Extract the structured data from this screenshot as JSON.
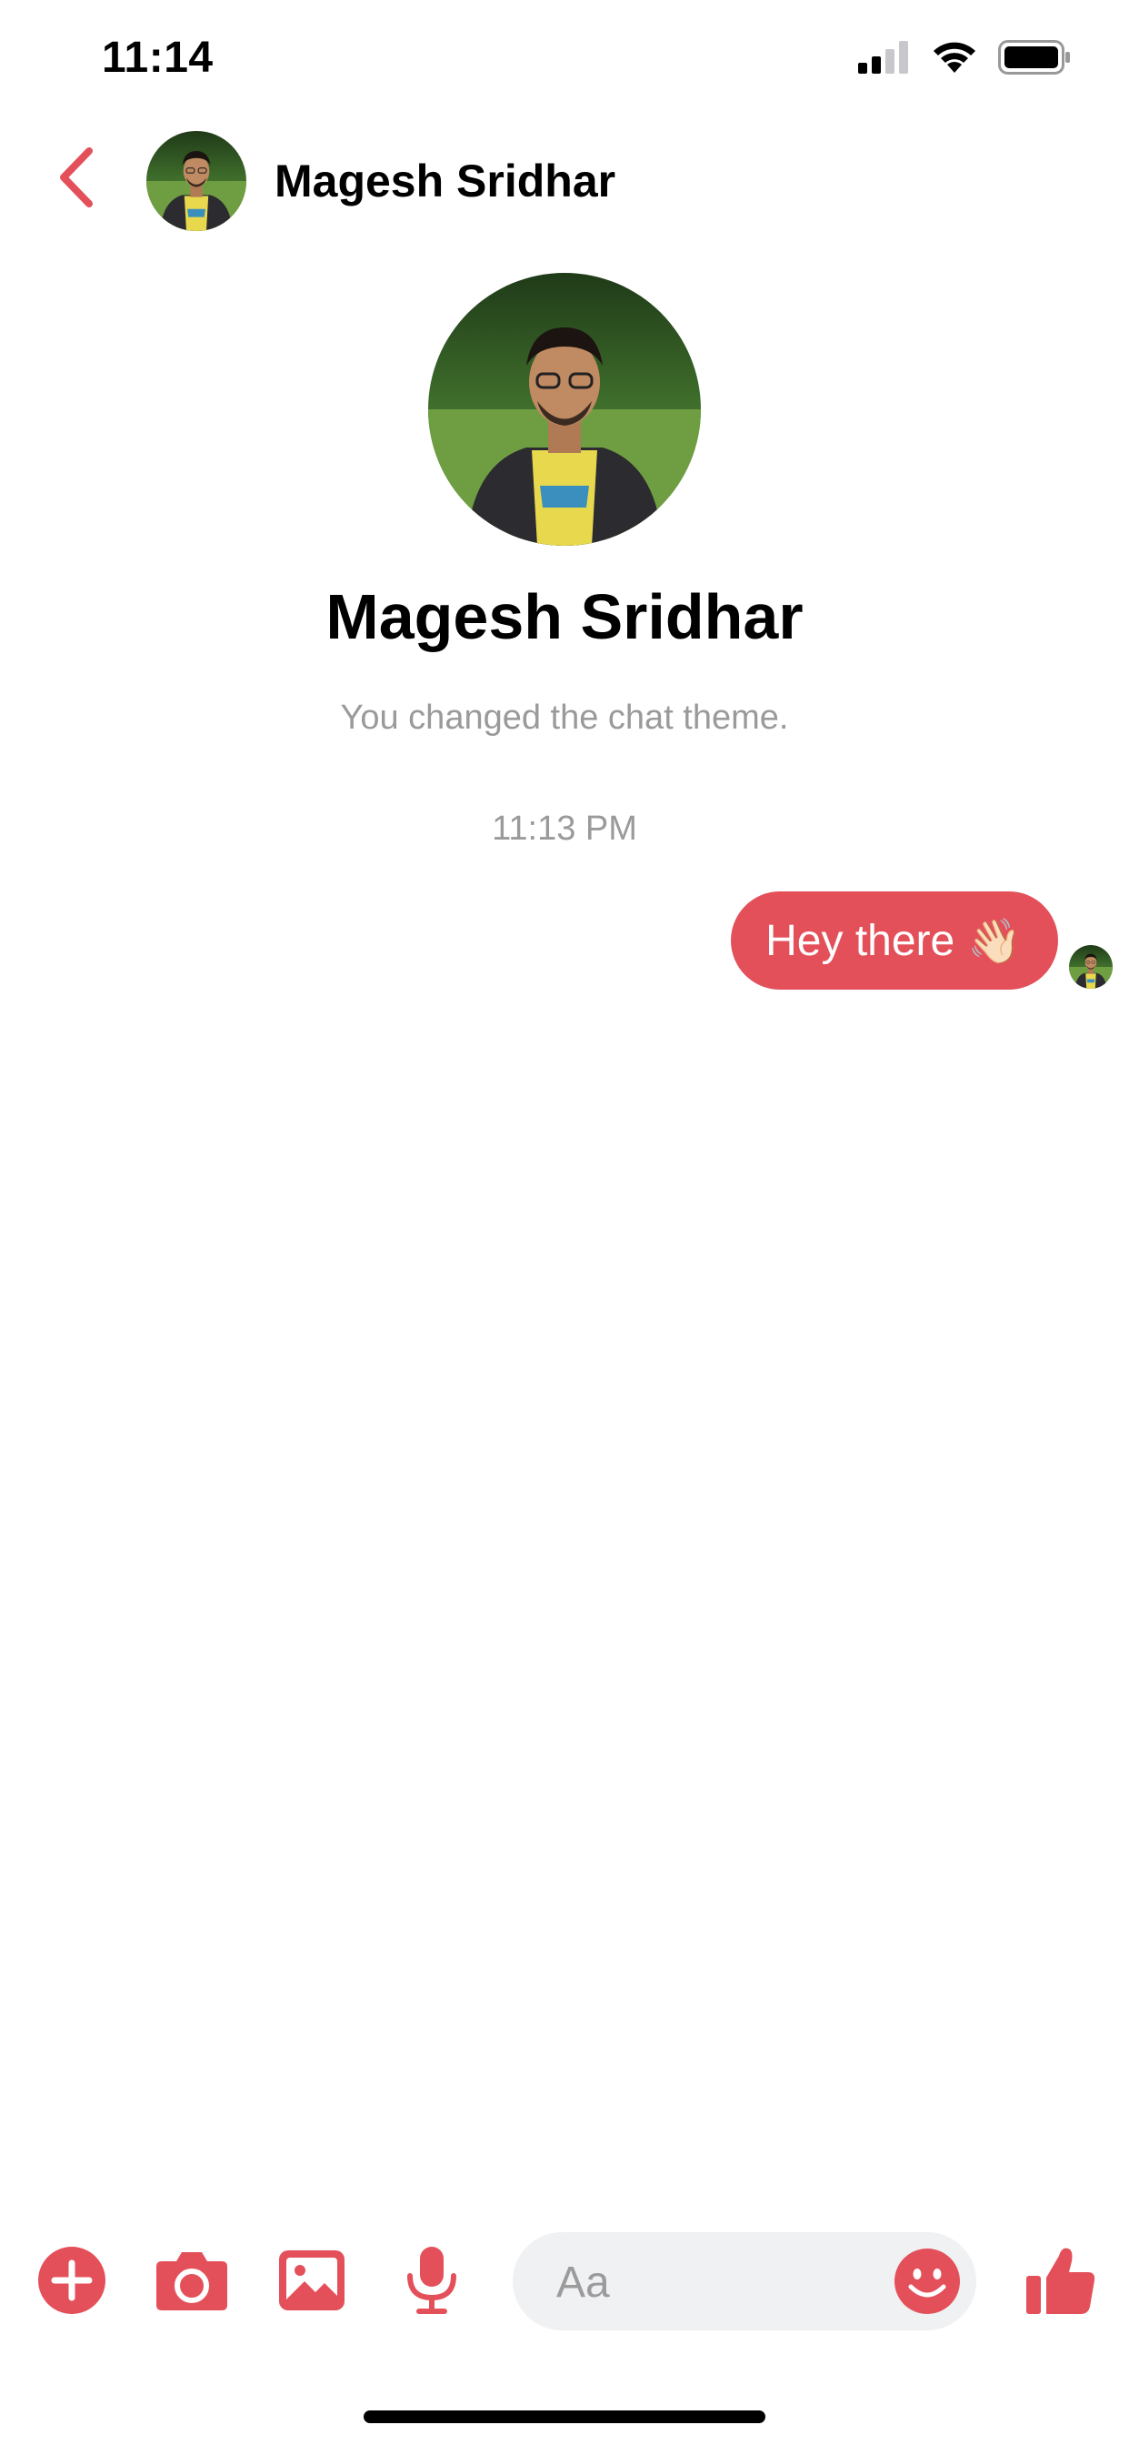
{
  "status_bar": {
    "time": "11:14"
  },
  "header": {
    "contact_name": "Magesh Sridhar",
    "back_icon": "chevron-left-icon"
  },
  "profile": {
    "name": "Magesh Sridhar"
  },
  "conversation": {
    "system_note": "You changed the chat theme.",
    "timestamp": "11:13 PM",
    "messages": [
      {
        "sender": "me",
        "text": "Hey there",
        "emoji": "👋🏻"
      }
    ]
  },
  "composer": {
    "placeholder": "Aa",
    "value": "",
    "icons": [
      "plus-icon",
      "camera-icon",
      "image-icon",
      "microphone-icon",
      "emoji-icon",
      "thumbs-up-icon"
    ]
  },
  "theme": {
    "accent": "#e4505a",
    "muted_text": "#9a9a9a",
    "input_bg": "#f0f1f3"
  }
}
